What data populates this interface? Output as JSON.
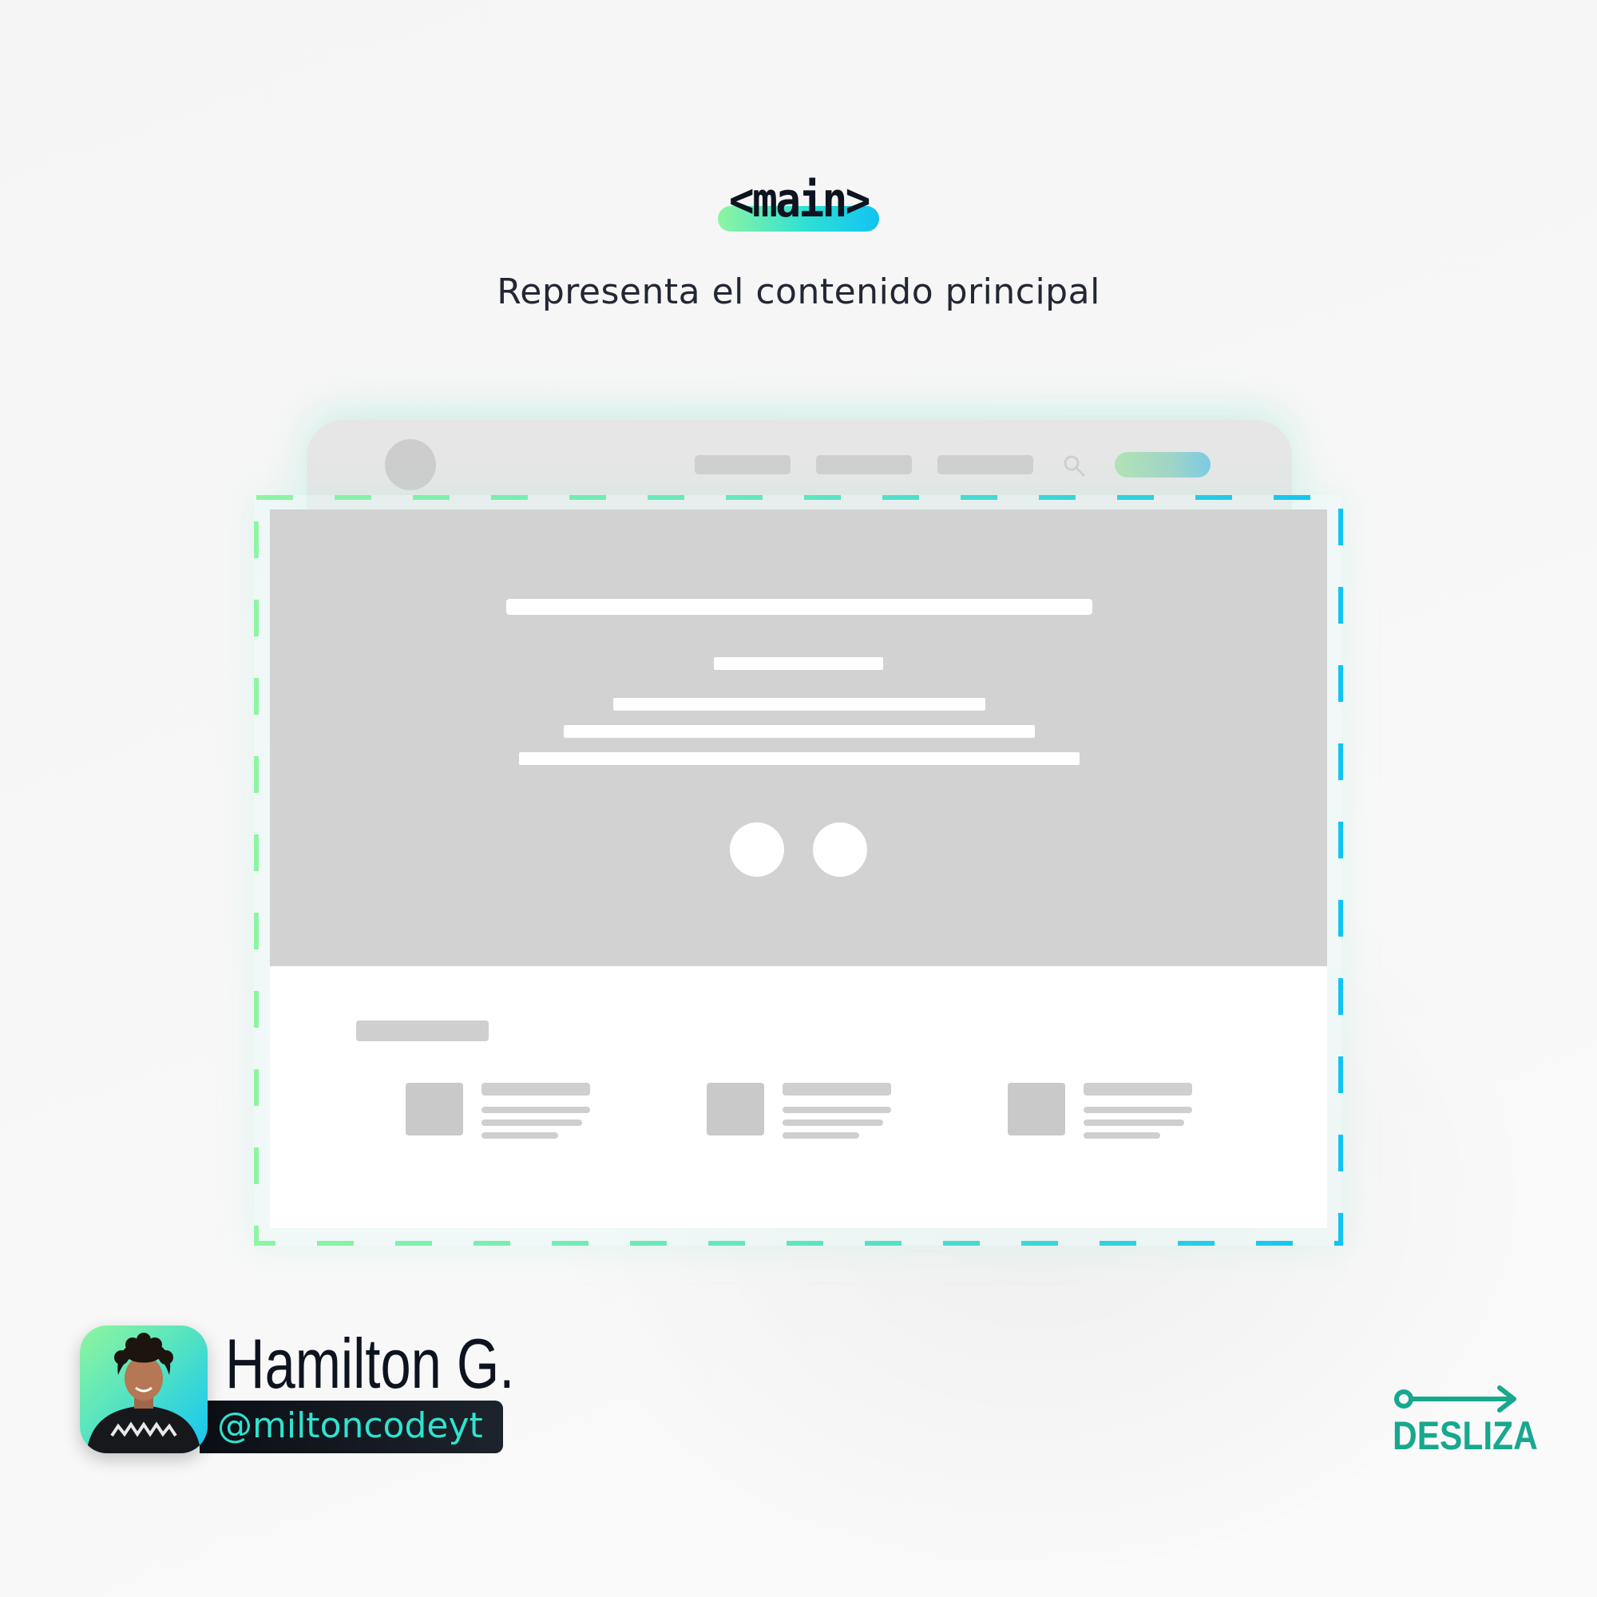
{
  "header": {
    "tag": "<main>",
    "description": "Representa el contenido principal"
  },
  "author": {
    "name": "Hamilton G.",
    "handle": "@miltoncodeyt"
  },
  "swipe": {
    "label": "DESLIZA"
  },
  "colors": {
    "accent_green": "#8ef5a2",
    "accent_blue": "#12c3f2",
    "swipe_teal": "#17a88e",
    "handle_text": "#2fe3cf",
    "dark_text": "#0d1420"
  },
  "icons": {
    "wireframe_search": "search-icon",
    "swipe": "arrow-right-icon"
  }
}
